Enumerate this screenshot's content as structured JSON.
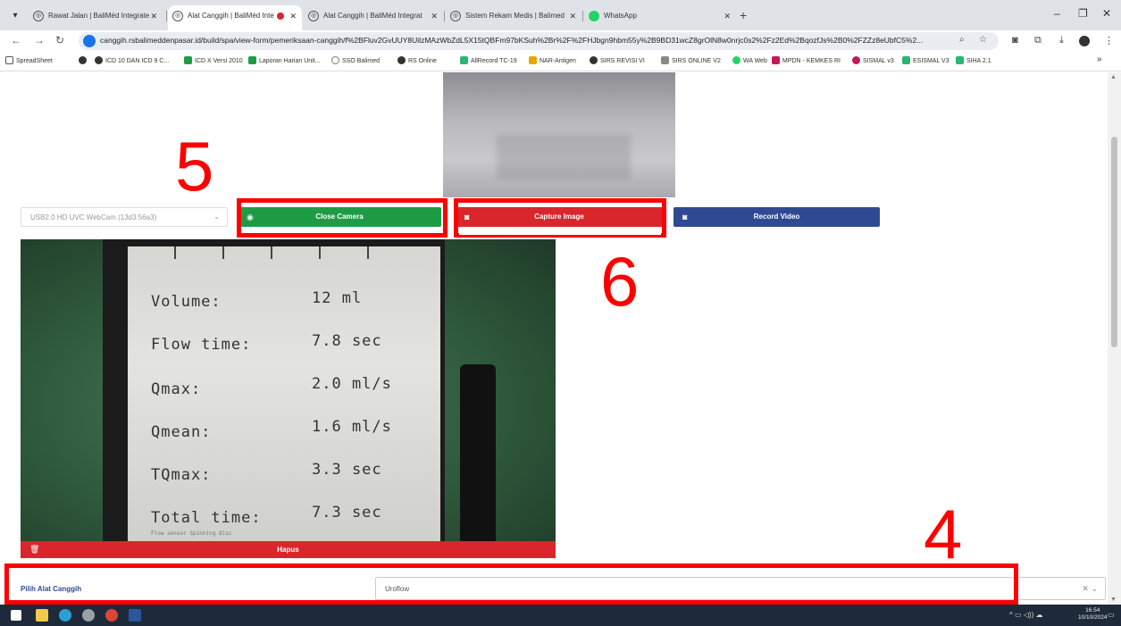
{
  "browser": {
    "tabs": [
      {
        "label": "Rawat Jalan | BaliMéd Integrate",
        "active": false
      },
      {
        "label": "Alat Canggih | BaliMéd Inte",
        "active": true
      },
      {
        "label": "Alat Canggih | BaliMéd Integrat",
        "active": false
      },
      {
        "label": "Sistem Rekam Medis | Balimed",
        "active": false
      },
      {
        "label": "WhatsApp",
        "active": false
      }
    ],
    "tab_close": "✕",
    "new_tab": "+",
    "url": "canggih.rsbalimeddenpasar.id/build/spa/view-form/pemeriksaan-canggih/f%2BFluv2GvUUY8UilzMAzWbZdL5X15tQBFm97bKSuh%2Br%2F%2FHJbgn9hbm55y%2B9BD31wcZ8grOlN8w0nrjc0s2%2Fz2Ed%2BqozfJs%2B0%2FZZz8eUbfC5%2...",
    "bookmarks": [
      {
        "label": "SpreadSheet",
        "color": "#555555"
      },
      {
        "label": "",
        "color": "#333333"
      },
      {
        "label": "ICD 10 DAN ICD 9 C...",
        "color": "#333333"
      },
      {
        "label": "ICD X Versi 2010",
        "color": "#1e9c45"
      },
      {
        "label": "Laporan Harian Unit...",
        "color": "#1e9c45"
      },
      {
        "label": "SSO Balimed",
        "color": "#777777"
      },
      {
        "label": "RS Online",
        "color": "#333333"
      },
      {
        "label": "AllRecord TC-19",
        "color": "#2bb673"
      },
      {
        "label": "NAR-Antigen",
        "color": "#e6a800"
      },
      {
        "label": "SIRS REVISI VI",
        "color": "#333333"
      },
      {
        "label": "SIRS ONLINE V2",
        "color": "#888888"
      },
      {
        "label": "WA Web",
        "color": "#25d366"
      },
      {
        "label": "MPDN - KEMKES RI",
        "color": "#c2185b"
      },
      {
        "label": "SISMAL v3",
        "color": "#c2185b"
      },
      {
        "label": "ESISMAL V3",
        "color": "#2bb673"
      },
      {
        "label": "SIHA 2.1",
        "color": "#2bb673"
      }
    ],
    "bookmarks_more": "»"
  },
  "camera": {
    "device_select": "USB2.0 HD UVC WebCam (13d3:56a3)",
    "close_label": "Close Camera",
    "capture_label": "Capture Image",
    "record_label": "Record Video",
    "delete_label": "Hapus"
  },
  "uroflow_display": {
    "rows": [
      {
        "label": "Volume:",
        "value": "12 ml"
      },
      {
        "label": "Flow time:",
        "value": "7.8 sec"
      },
      {
        "label": "Qmax:",
        "value": "2.0 ml/s"
      },
      {
        "label": "Qmean:",
        "value": "1.6 ml/s"
      },
      {
        "label": "TQmax:",
        "value": "3.3 sec"
      },
      {
        "label": "Total time:",
        "value": "7.3 sec"
      }
    ],
    "footer": "Flow sensor  Spinning disc"
  },
  "form": {
    "label": "Pilih Alat Canggih",
    "value": "Uroflow"
  },
  "annotations": {
    "n4": "4",
    "n5": "5",
    "n6": "6",
    "color": "#ff0000"
  },
  "taskbar": {
    "time": "16.54",
    "date": "10/10/2024"
  }
}
